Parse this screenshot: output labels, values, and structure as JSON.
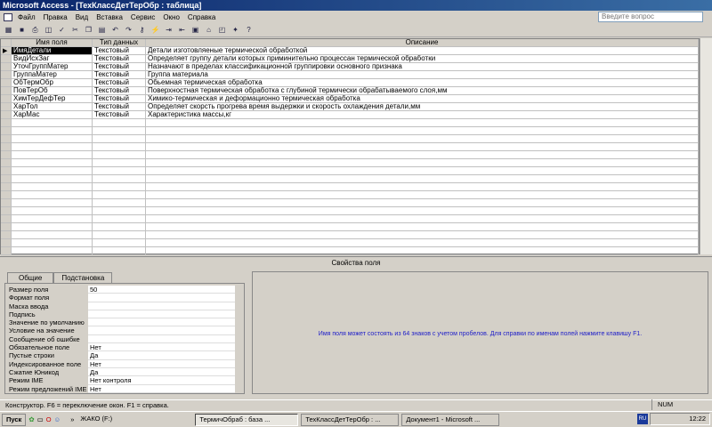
{
  "window": {
    "title": "Microsoft Access - [ТехКлассДетТерОбр : таблица]"
  },
  "menu": [
    "Файл",
    "Правка",
    "Вид",
    "Вставка",
    "Сервис",
    "Окно",
    "Справка"
  ],
  "help_placeholder": "Введите вопрос",
  "grid": {
    "headers": [
      "Имя поля",
      "Тип данных",
      "Описание"
    ],
    "rows": [
      [
        "ИмяДетали",
        "Текстовый",
        "Детали изготовляеные термической обработкой"
      ],
      [
        "ВидИсхЗаг",
        "Текстовый",
        "Определяет группу детали которых приминительно процессан термической обработки"
      ],
      [
        "УточГруппМатер",
        "Текстовый",
        "Назначают в пределах классификационной группировки основного признака"
      ],
      [
        "ГруппаМатер",
        "Текстовый",
        "Группа материала"
      ],
      [
        "ОбТермОбр",
        "Текстовый",
        "Обьемная термическая обработка"
      ],
      [
        "ПовТерОб",
        "Текстовый",
        "Поверхностная термическая обработка с глубиной термически обрабатываемого слоя,мм"
      ],
      [
        "ХимТерДефТер",
        "Текстовый",
        "Химико-термическая и деформационно термическая обработка"
      ],
      [
        "ХарТол",
        "Текстовый",
        "Определяет скорсть прогрева время выдержки и скорость охлаждения детали,мм"
      ],
      [
        "ХарМас",
        "Текстовый",
        "Характеристика массы,кг"
      ]
    ]
  },
  "properties": {
    "label": "Свойства поля",
    "tabs": [
      "Общие",
      "Подстановка"
    ],
    "rows": [
      [
        "Размер поля",
        "50"
      ],
      [
        "Формат поля",
        ""
      ],
      [
        "Маска ввода",
        ""
      ],
      [
        "Подпись",
        ""
      ],
      [
        "Значение по умолчанию",
        ""
      ],
      [
        "Условие на значение",
        ""
      ],
      [
        "Сообщение об ошибке",
        ""
      ],
      [
        "Обязательное поле",
        "Нет"
      ],
      [
        "Пустые строки",
        "Да"
      ],
      [
        "Индексированное поле",
        "Нет"
      ],
      [
        "Сжатие Юникод",
        "Да"
      ],
      [
        "Режим IME",
        "Нет контроля"
      ],
      [
        "Режим предложений IME",
        "Нет"
      ]
    ],
    "hint": "Имя поля может состоять из 64 знаков с учетом пробелов.  Для справки по именам полей нажмите клавишу F1."
  },
  "status": {
    "text": "Конструктор.  F6 = переключение окон.  F1 = справка.",
    "num": "NUM"
  },
  "taskbar": {
    "start": "Пуск",
    "drive": "ЖАКО (F:)",
    "items": [
      "ТермичОбраб : база ...",
      "ТехКлассДетТерОбр : ...",
      "Документ1 - Microsoft ..."
    ],
    "lang": "RU",
    "time": "12:22"
  }
}
